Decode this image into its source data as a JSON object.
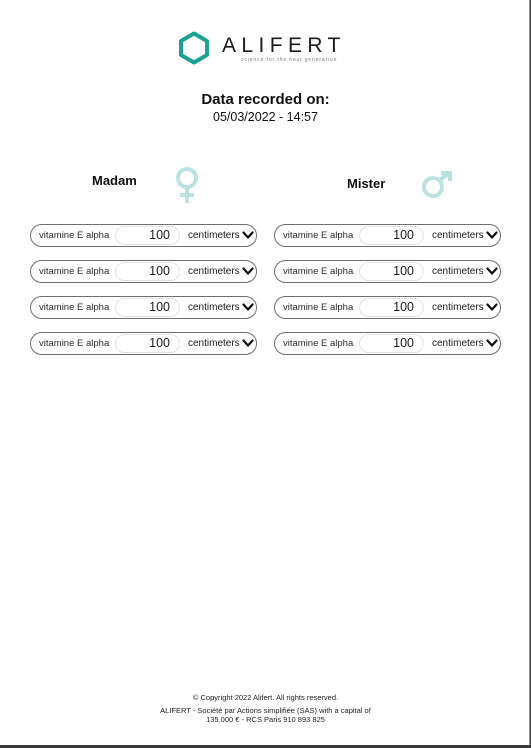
{
  "brand": {
    "name": "ALIFERT",
    "tagline": "science for the next generation",
    "color": "#1aa394"
  },
  "recorded": {
    "title": "Data recorded on:",
    "date": "05/03/2022 - 14:57"
  },
  "columns": [
    {
      "title": "Madam",
      "icon": "female-symbol-icon",
      "icon_color": "#b9e2e0",
      "rows": [
        {
          "label": "vitamine E alpha",
          "value": "100",
          "unit": "centimeters"
        },
        {
          "label": "vitamine E alpha",
          "value": "100",
          "unit": "centimeters"
        },
        {
          "label": "vitamine E alpha",
          "value": "100",
          "unit": "centimeters"
        },
        {
          "label": "vitamine E alpha",
          "value": "100",
          "unit": "centimeters"
        }
      ]
    },
    {
      "title": "Mister",
      "icon": "male-symbol-icon",
      "icon_color": "#b9e2e0",
      "rows": [
        {
          "label": "vitamine E alpha",
          "value": "100",
          "unit": "centimeters"
        },
        {
          "label": "vitamine E alpha",
          "value": "100",
          "unit": "centimeters"
        },
        {
          "label": "vitamine E alpha",
          "value": "100",
          "unit": "centimeters"
        },
        {
          "label": "vitamine E alpha",
          "value": "100",
          "unit": "centimeters"
        }
      ]
    }
  ],
  "footer": {
    "copyright": "© Copyright 2022 Alifert. All rights reserved.",
    "company_line1": "ALIFERT - Société par Actions simplifiée (SAS) with a capital of",
    "company_line2": "135.000 € - RCS Paris 910 893 825"
  }
}
